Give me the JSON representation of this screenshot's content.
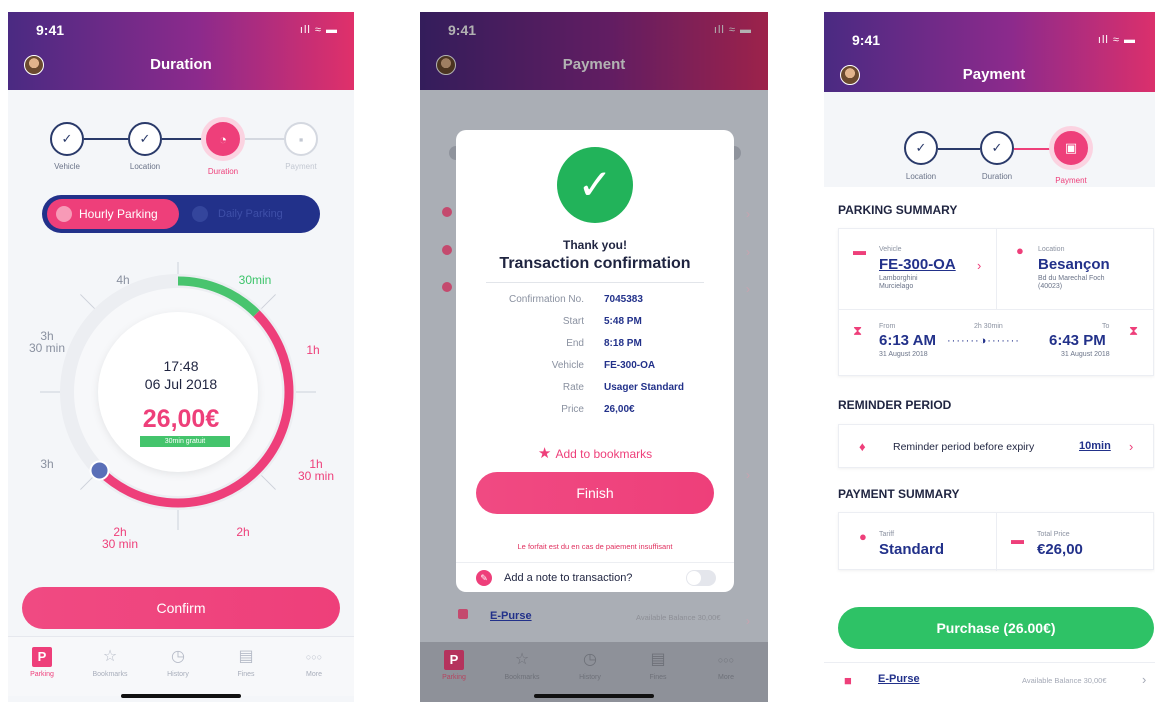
{
  "status": {
    "time": "9:41",
    "sys_icons": "ıll ≈ ▬"
  },
  "colors": {
    "accent_pink": "#ee3f7a",
    "navy": "#22318a",
    "green": "#2ec266"
  },
  "screen_duration": {
    "title": "Duration",
    "steps": [
      {
        "label": "Vehicle",
        "state": "done"
      },
      {
        "label": "Location",
        "state": "done"
      },
      {
        "label": "Duration",
        "state": "active"
      },
      {
        "label": "Payment",
        "state": "off"
      }
    ],
    "mode_toggle": {
      "selected": "Hourly Parking",
      "other": "Daily Parking"
    },
    "dial": {
      "labels": {
        "m30": "30min",
        "h1": "1h",
        "h1_30": "1h\n30 min",
        "h2": "2h",
        "h2_30": "2h\n30 min",
        "h3": "3h",
        "h3_30": "3h\n30 min",
        "h4": "4h"
      },
      "time": "17:48",
      "date": "06 Jul 2018",
      "price": "26,00€",
      "free_badge": "30min gratuit",
      "selected_fraction": 0.625
    },
    "confirm_label": "Confirm"
  },
  "tabs": [
    {
      "label": "Parking",
      "icon": "parking-icon",
      "glyph": "P"
    },
    {
      "label": "Bookmarks",
      "icon": "star-icon",
      "glyph": "☆"
    },
    {
      "label": "History",
      "icon": "clock-icon",
      "glyph": "◷"
    },
    {
      "label": "Fines",
      "icon": "ticket-icon",
      "glyph": "▤"
    },
    {
      "label": "More",
      "icon": "more-icon",
      "glyph": "○○○"
    }
  ],
  "screen_confirm": {
    "title": "Payment",
    "modal": {
      "thanks": "Thank you!",
      "heading": "Transaction confirmation",
      "details": [
        {
          "key": "Confirmation No.",
          "value": "7045383"
        },
        {
          "key": "Start",
          "value": "5:48 PM"
        },
        {
          "key": "End",
          "value": "8:18 PM"
        },
        {
          "key": "Vehicle",
          "value": "FE-300-OA"
        },
        {
          "key": "Rate",
          "value": "Usager Standard"
        },
        {
          "key": "Price",
          "value": "26,00€"
        }
      ],
      "bookmark_label": "Add to bookmarks",
      "finish_label": "Finish",
      "footnote": "Le forfait est du en cas de paiement insuffisant",
      "note_label": "Add a note to transaction?"
    },
    "bg_epurse": {
      "name": "E-Purse",
      "balance": "Available Balance 30,00€"
    }
  },
  "screen_payment": {
    "title": "Payment",
    "steps": [
      {
        "label": "Location",
        "state": "done"
      },
      {
        "label": "Duration",
        "state": "done"
      },
      {
        "label": "Payment",
        "state": "active"
      }
    ],
    "parking_summary": {
      "heading": "PARKING SUMMARY",
      "vehicle": {
        "key": "Vehicle",
        "plate": "FE-300-OA",
        "line1": "Lamborghini",
        "line2": "Murcielago"
      },
      "location": {
        "key": "Location",
        "city": "Besançon",
        "line1": "Bd du Marechal Foch",
        "line2": "(40023)"
      },
      "from": {
        "key": "From",
        "time": "6:13 AM",
        "date": "31 August 2018"
      },
      "to": {
        "key": "To",
        "time": "6:43 PM",
        "date": "31 August 2018"
      },
      "duration": "2h 30min"
    },
    "reminder": {
      "heading": "REMINDER PERIOD",
      "text": "Reminder period before expiry",
      "value": "10min"
    },
    "payment_summary": {
      "heading": "PAYMENT SUMMARY",
      "tariff_key": "Tariff",
      "tariff": "Standard",
      "total_key": "Total Price",
      "total": "€26,00"
    },
    "purchase_label": "Purchase (26.00€)",
    "epurse": {
      "name": "E-Purse",
      "balance": "Available Balance 30,00€"
    }
  }
}
